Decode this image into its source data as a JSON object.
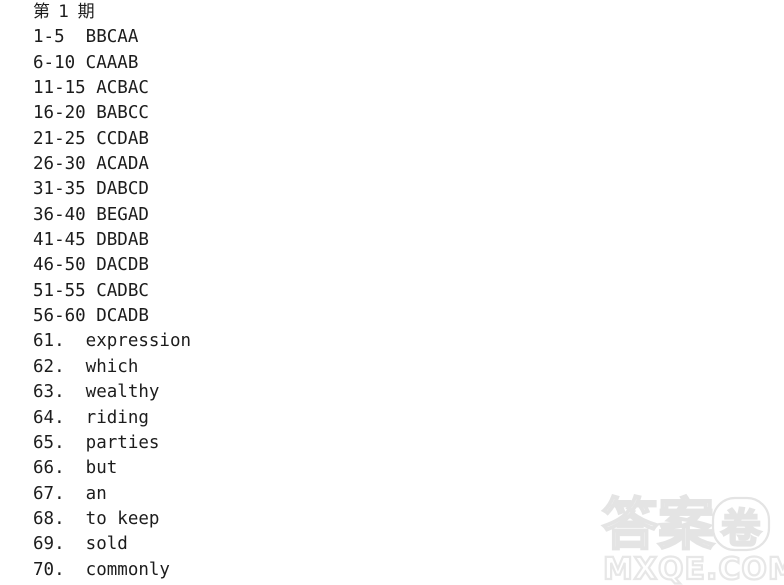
{
  "document": {
    "background_color": "#ffffff",
    "text_color": "#1c1c1c",
    "heading": "第 1 期",
    "lines": [
      {
        "id": "line-heading",
        "text": "第 1 期",
        "kind": "heading"
      },
      {
        "id": "line-1-5",
        "text": "1-5  BBCAA",
        "kind": "range"
      },
      {
        "id": "line-6-10",
        "text": "6-10 CAAAB",
        "kind": "range"
      },
      {
        "id": "line-11-15",
        "text": "11-15 ACBAC",
        "kind": "range"
      },
      {
        "id": "line-16-20",
        "text": "16-20 BABCC",
        "kind": "range"
      },
      {
        "id": "line-21-25",
        "text": "21-25 CCDAB",
        "kind": "range"
      },
      {
        "id": "line-26-30",
        "text": "26-30 ACADA",
        "kind": "range"
      },
      {
        "id": "line-31-35",
        "text": "31-35 DABCD",
        "kind": "range"
      },
      {
        "id": "line-36-40",
        "text": "36-40 BEGAD",
        "kind": "range"
      },
      {
        "id": "line-41-45",
        "text": "41-45 DBDAB",
        "kind": "range"
      },
      {
        "id": "line-46-50",
        "text": "46-50 DACDB",
        "kind": "range"
      },
      {
        "id": "line-51-55",
        "text": "51-55 CADBC",
        "kind": "range"
      },
      {
        "id": "line-56-60",
        "text": "56-60 DCADB",
        "kind": "range"
      },
      {
        "id": "line-61",
        "text": "61.  expression",
        "kind": "word"
      },
      {
        "id": "line-62",
        "text": "62.  which",
        "kind": "word"
      },
      {
        "id": "line-63",
        "text": "63.  wealthy",
        "kind": "word"
      },
      {
        "id": "line-64",
        "text": "64.  riding",
        "kind": "word"
      },
      {
        "id": "line-65",
        "text": "65.  parties",
        "kind": "word"
      },
      {
        "id": "line-66",
        "text": "66.  but",
        "kind": "word"
      },
      {
        "id": "line-67",
        "text": "67.  an",
        "kind": "word"
      },
      {
        "id": "line-68",
        "text": "68.  to keep",
        "kind": "word"
      },
      {
        "id": "line-69",
        "text": "69.  sold",
        "kind": "word"
      },
      {
        "id": "line-70",
        "text": "70.  commonly",
        "kind": "word"
      }
    ],
    "multiple_choice_answers": [
      {
        "range": "1-5",
        "answers": "BBCAA"
      },
      {
        "range": "6-10",
        "answers": "CAAAB"
      },
      {
        "range": "11-15",
        "answers": "ACBAC"
      },
      {
        "range": "16-20",
        "answers": "BABCC"
      },
      {
        "range": "21-25",
        "answers": "CCDAB"
      },
      {
        "range": "26-30",
        "answers": "ACADA"
      },
      {
        "range": "31-35",
        "answers": "DABCD"
      },
      {
        "range": "36-40",
        "answers": "BEGAD"
      },
      {
        "range": "41-45",
        "answers": "DBDAB"
      },
      {
        "range": "46-50",
        "answers": "DACDB"
      },
      {
        "range": "51-55",
        "answers": "CADBC"
      },
      {
        "range": "56-60",
        "answers": "DCADB"
      }
    ],
    "word_answers": [
      {
        "number": "61.",
        "answer": "expression"
      },
      {
        "number": "62.",
        "answer": "which"
      },
      {
        "number": "63.",
        "answer": "wealthy"
      },
      {
        "number": "64.",
        "answer": "riding"
      },
      {
        "number": "65.",
        "answer": "parties"
      },
      {
        "number": "66.",
        "answer": "but"
      },
      {
        "number": "67.",
        "answer": "an"
      },
      {
        "number": "68.",
        "answer": "to keep"
      },
      {
        "number": "69.",
        "answer": "sold"
      },
      {
        "number": "70.",
        "answer": "commonly"
      }
    ]
  },
  "watermark": {
    "cjk_text": "答案",
    "circled_char": "卷",
    "domain_text": "MXQE.COM",
    "color": "#e5e5e5"
  }
}
